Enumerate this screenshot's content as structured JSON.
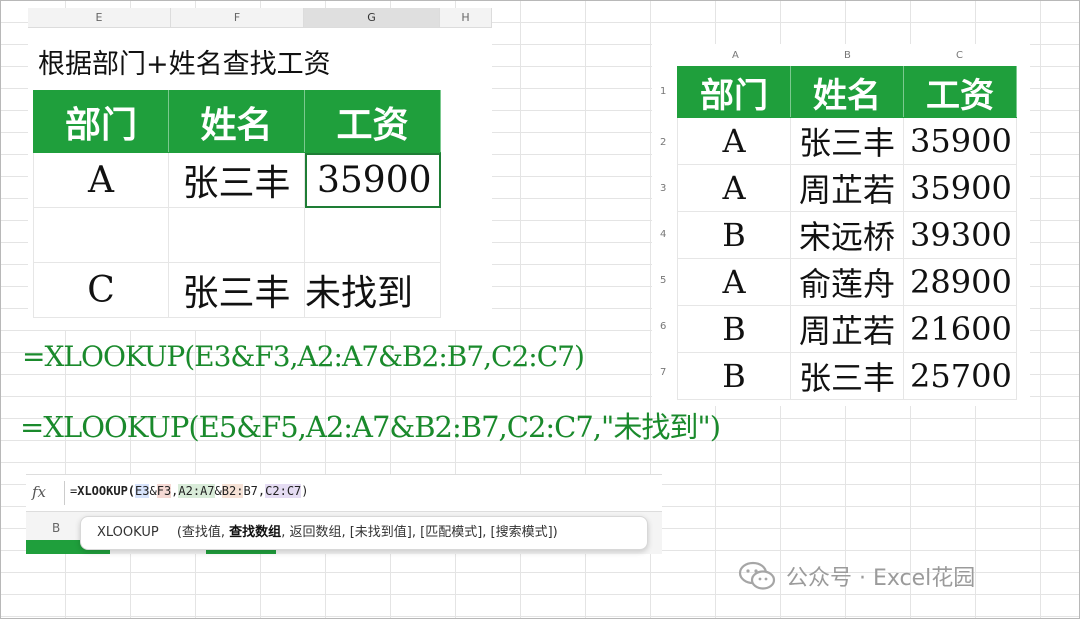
{
  "left_sheet": {
    "col_headers": [
      "E",
      "F",
      "G",
      "H"
    ],
    "title": "根据部门+姓名查找工资",
    "headers": [
      "部门",
      "姓名",
      "工资"
    ],
    "rows": [
      {
        "dept": "A",
        "name": "张三丰",
        "salary": "35900"
      },
      {
        "dept": "C",
        "name": "张三丰",
        "salary": "未找到"
      }
    ]
  },
  "right_sheet": {
    "col_headers": [
      "A",
      "B",
      "C"
    ],
    "row_numbers": [
      "1",
      "2",
      "3",
      "4",
      "5",
      "6",
      "7"
    ],
    "headers": [
      "部门",
      "姓名",
      "工资"
    ],
    "rows": [
      {
        "dept": "A",
        "name": "张三丰",
        "salary": "35900"
      },
      {
        "dept": "A",
        "name": "周芷若",
        "salary": "35900"
      },
      {
        "dept": "B",
        "name": "宋远桥",
        "salary": "39300"
      },
      {
        "dept": "A",
        "name": "俞莲舟",
        "salary": "28900"
      },
      {
        "dept": "B",
        "name": "周芷若",
        "salary": "21600"
      },
      {
        "dept": "B",
        "name": "张三丰",
        "salary": "25700"
      }
    ]
  },
  "formulas": {
    "f1": "=XLOOKUP(E3&F3,A2:A7&B2:B7,C2:C7)",
    "f2": "=XLOOKUP(E5&F5,A2:A7&B2:B7,C2:C7,\"未找到\")"
  },
  "formula_bar": {
    "fx": "fx",
    "eq": "=",
    "func": "XLOOKUP(",
    "ref1": "E3",
    "amp1": "&",
    "ref2": "F3",
    "comma1": ",",
    "ref3": "A2:A7",
    "amp2": "&",
    "ref4": "B2:",
    "ref4b": "B7",
    "comma2": ",",
    "ref5": "C2:C7",
    "close": ")",
    "strip_col": "B"
  },
  "tooltip": {
    "func": "XLOOKUP",
    "open": "(查找值, ",
    "bold": "查找数组",
    "rest": ", 返回数组, [未找到值], [匹配模式], [搜索模式])"
  },
  "watermark": {
    "text": "公众号 · Excel花园"
  },
  "colors": {
    "header_green": "#1f9f3c",
    "formula_green": "#1a8a2c"
  }
}
